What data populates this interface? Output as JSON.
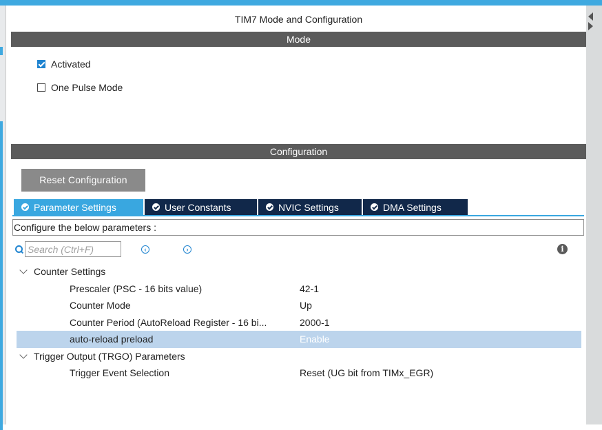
{
  "window": {
    "title": "TIM7 Mode and Configuration"
  },
  "mode_section": {
    "header": "Mode",
    "options": [
      {
        "label": "Activated",
        "checked": true
      },
      {
        "label": "One Pulse Mode",
        "checked": false
      }
    ]
  },
  "config_section": {
    "header": "Configuration",
    "reset_button": "Reset Configuration",
    "tabs": [
      {
        "label": "Parameter Settings",
        "active": true
      },
      {
        "label": "User Constants",
        "active": false
      },
      {
        "label": "NVIC Settings",
        "active": false
      },
      {
        "label": "DMA Settings",
        "active": false
      }
    ],
    "instruction": "Configure the below parameters :",
    "search": {
      "placeholder": "Search (Ctrl+F)"
    },
    "groups": [
      {
        "label": "Counter Settings",
        "params": [
          {
            "name": "Prescaler (PSC - 16 bits value)",
            "value": "42-1"
          },
          {
            "name": "Counter Mode",
            "value": "Up"
          },
          {
            "name": "Counter Period (AutoReload Register - 16 bi...",
            "value": "2000-1"
          },
          {
            "name": "auto-reload preload",
            "value": "Enable",
            "selected": true
          }
        ]
      },
      {
        "label": "Trigger Output (TRGO) Parameters",
        "params": [
          {
            "name": "Trigger Event Selection",
            "value": "Reset (UG bit from TIMx_EGR)"
          }
        ]
      }
    ]
  },
  "colors": {
    "accent": "#39a7e0",
    "tab_inactive": "#11284a",
    "section_header": "#5b5b5b",
    "selection": "#bcd4ec"
  }
}
